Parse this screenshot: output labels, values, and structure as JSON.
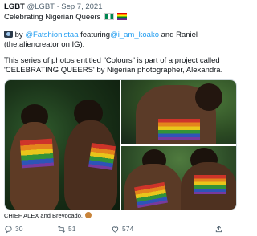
{
  "tweet": {
    "display_name": "LGBT",
    "handle": "@LGBT",
    "separator": "·",
    "date": "Sep 7, 2021",
    "title": "Celebrating Nigerian Queers",
    "credit_prefix": "by",
    "credit_photographer": "@Fatshionistaa",
    "credit_middle": "featuring",
    "credit_model": "@i_am_koako",
    "credit_suffix": "and Raniel (the.aliencreator on IG).",
    "description": "This series of photos entitled \"Colours\" is part of a project called 'CELEBRATING QUEERS' by Nigerian photographer, Alexandra.",
    "media_caption": "CHIEF ALEX and Brevocado."
  },
  "actions": {
    "replies": "30",
    "retweets": "51",
    "likes": "574"
  },
  "icons": {
    "camera": "camera-icon",
    "flag_ng": "nigeria-flag-icon",
    "flag_rainbow": "rainbow-flag-icon",
    "reply": "reply-icon",
    "retweet": "retweet-icon",
    "like": "heart-icon",
    "share": "share-icon"
  },
  "colors": {
    "link": "#1d9bf0",
    "muted": "#536471",
    "text": "#0f1419"
  }
}
